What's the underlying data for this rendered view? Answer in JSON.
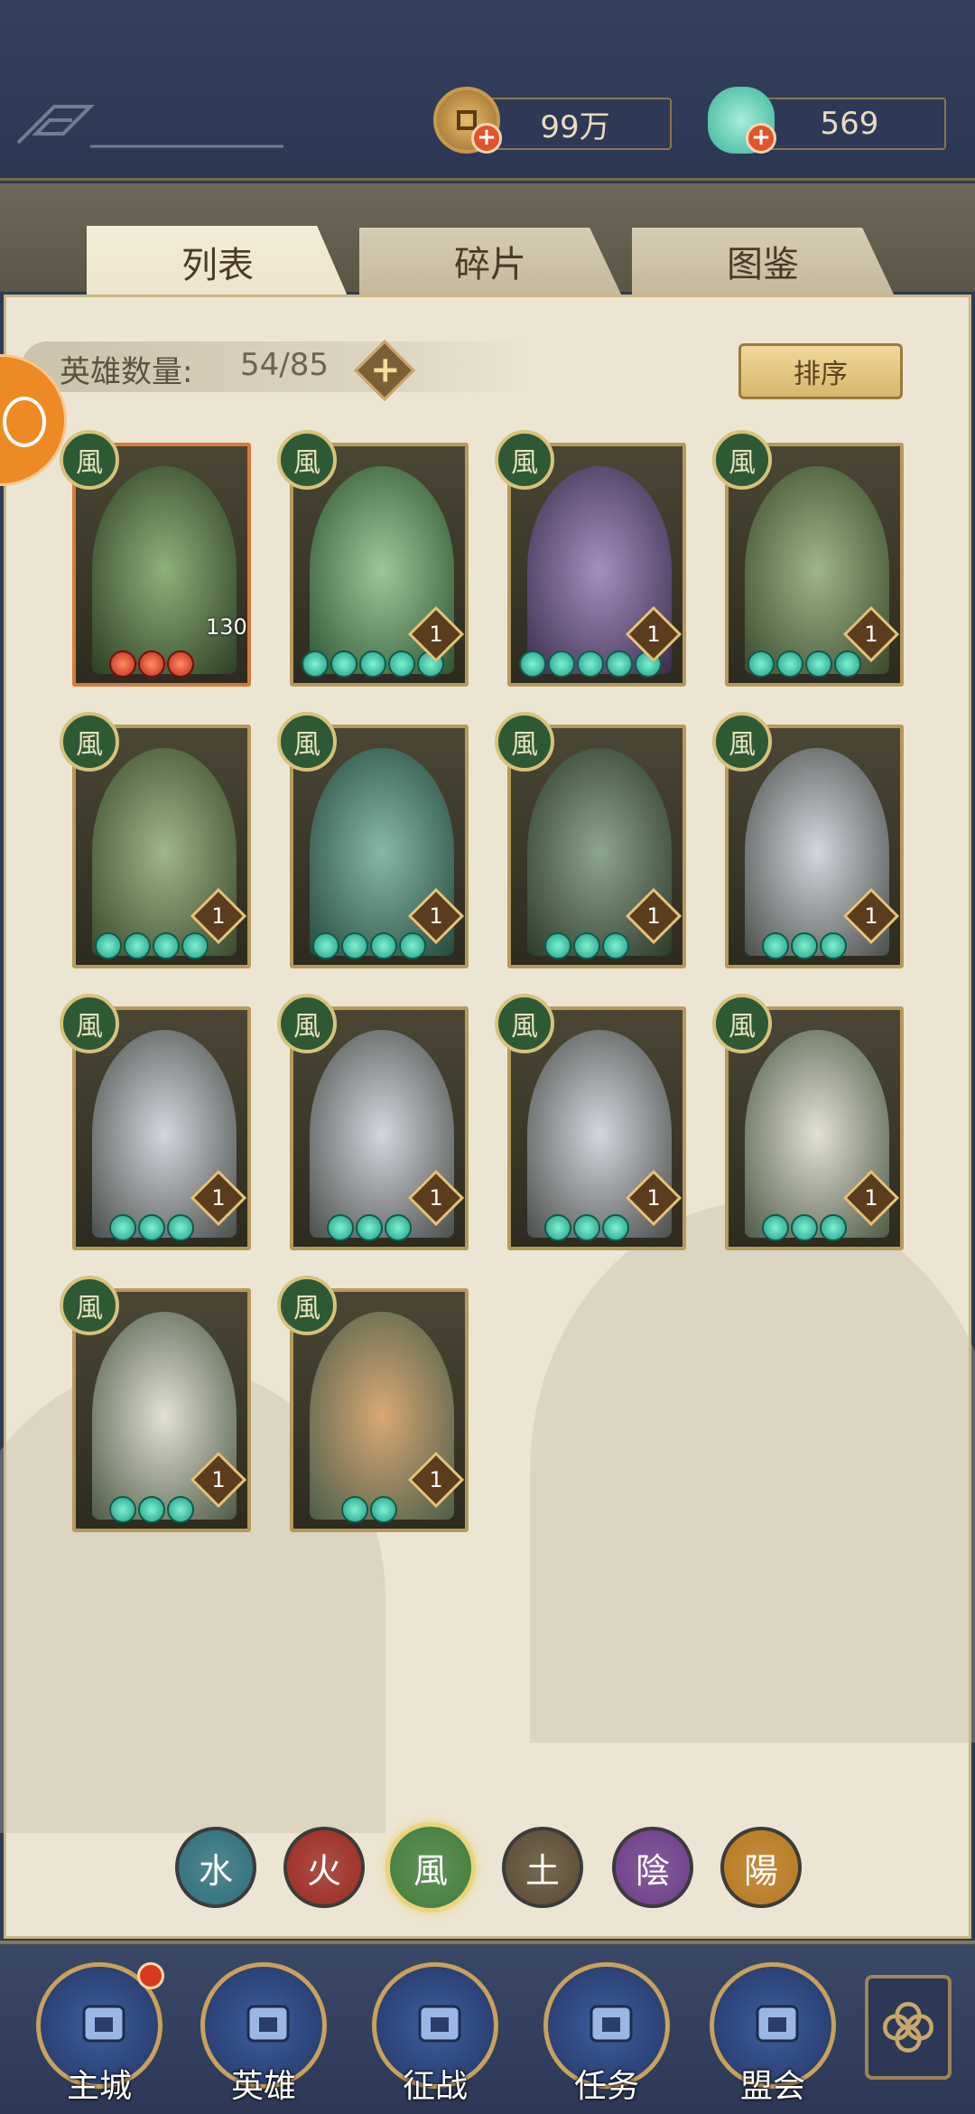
{
  "topbar": {
    "coins": {
      "value": "99万",
      "icon": "coin-icon"
    },
    "jade": {
      "value": "569",
      "icon": "jade-pouch-icon"
    }
  },
  "tabs": [
    {
      "label": "列表",
      "active": true
    },
    {
      "label": "碎片",
      "active": false
    },
    {
      "label": "图鉴",
      "active": false
    }
  ],
  "hero_count": {
    "label": "英雄数量:",
    "value": "54/85"
  },
  "sort_label": "排序",
  "element_badge_text": "風",
  "heroes": [
    {
      "level": "130",
      "stars": 3,
      "star_color": "red"
    },
    {
      "level": "1",
      "stars": 5,
      "star_color": "teal"
    },
    {
      "level": "1",
      "stars": 5,
      "star_color": "teal"
    },
    {
      "level": "1",
      "stars": 4,
      "star_color": "teal"
    },
    {
      "level": "1",
      "stars": 4,
      "star_color": "teal"
    },
    {
      "level": "1",
      "stars": 4,
      "star_color": "teal"
    },
    {
      "level": "1",
      "stars": 3,
      "star_color": "teal"
    },
    {
      "level": "1",
      "stars": 3,
      "star_color": "teal"
    },
    {
      "level": "1",
      "stars": 3,
      "star_color": "teal"
    },
    {
      "level": "1",
      "stars": 3,
      "star_color": "teal"
    },
    {
      "level": "1",
      "stars": 3,
      "star_color": "teal"
    },
    {
      "level": "1",
      "stars": 3,
      "star_color": "teal"
    },
    {
      "level": "1",
      "stars": 3,
      "star_color": "teal"
    },
    {
      "level": "1",
      "stars": 2,
      "star_color": "teal"
    }
  ],
  "element_filters": [
    {
      "glyph": "水",
      "color": "#2c6f7d",
      "selected": false
    },
    {
      "glyph": "火",
      "color": "#9c2a22",
      "selected": false
    },
    {
      "glyph": "風",
      "color": "#3f7d3a",
      "selected": true
    },
    {
      "glyph": "土",
      "color": "#5a4a33",
      "selected": false
    },
    {
      "glyph": "陰",
      "color": "#6b3b8a",
      "selected": false
    },
    {
      "glyph": "陽",
      "color": "#b8781e",
      "selected": false
    }
  ],
  "bottom_nav": [
    {
      "label": "主城",
      "icon": "city-gate-icon",
      "has_notification": true
    },
    {
      "label": "英雄",
      "icon": "hero-portrait-icon",
      "has_notification": false
    },
    {
      "label": "征战",
      "icon": "battle-flag-icon",
      "has_notification": false
    },
    {
      "label": "任务",
      "icon": "quest-scroll-icon",
      "has_notification": false
    },
    {
      "label": "盟会",
      "icon": "guild-pavilion-icon",
      "has_notification": false
    }
  ],
  "menu_icon": "menu-knot-icon"
}
